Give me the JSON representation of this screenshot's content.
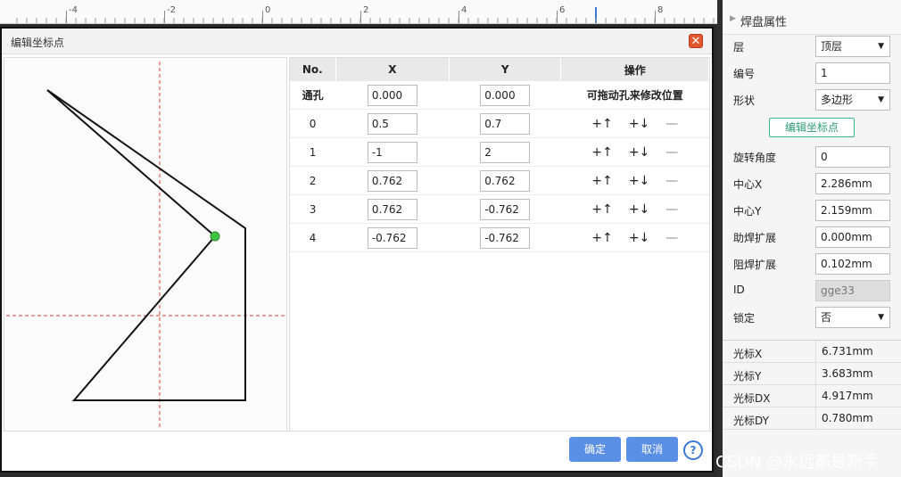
{
  "ruler": {
    "labels": [
      "-4",
      "-2",
      "0",
      "2",
      "4",
      "6",
      "8"
    ]
  },
  "dialog": {
    "title": "编辑坐标点",
    "close_icon": "close-icon",
    "columns": [
      "No.",
      "X",
      "Y",
      "操作"
    ],
    "hole_row": {
      "label": "通孔",
      "x": "0.000",
      "y": "0.000",
      "hint": "可拖动孔来修改位置"
    },
    "rows": [
      {
        "no": "0",
        "x": "0.5",
        "y": "0.7"
      },
      {
        "no": "1",
        "x": "-1",
        "y": "2"
      },
      {
        "no": "2",
        "x": "0.762",
        "y": "0.762"
      },
      {
        "no": "3",
        "x": "0.762",
        "y": "-0.762"
      },
      {
        "no": "4",
        "x": "-0.762",
        "y": "-0.762"
      }
    ],
    "ops": {
      "up": "+↑",
      "down": "+↓",
      "delete": "—"
    },
    "ok_label": "确定",
    "cancel_label": "取消",
    "help_label": "?"
  },
  "panel": {
    "title": "焊盘属性",
    "edit_button": "编辑坐标点",
    "fields": {
      "layer": {
        "label": "层",
        "value": "顶层"
      },
      "number": {
        "label": "编号",
        "value": "1"
      },
      "shape": {
        "label": "形状",
        "value": "多边形"
      },
      "rotation": {
        "label": "旋转角度",
        "value": "0"
      },
      "center_x": {
        "label": "中心X",
        "value": "2.286mm"
      },
      "center_y": {
        "label": "中心Y",
        "value": "2.159mm"
      },
      "paste": {
        "label": "助焊扩展",
        "value": "0.000mm"
      },
      "mask": {
        "label": "阻焊扩展",
        "value": "0.102mm"
      },
      "id": {
        "label": "ID",
        "value": "gge33"
      },
      "lock": {
        "label": "锁定",
        "value": "否"
      }
    },
    "cursor": [
      {
        "label": "光标X",
        "value": "6.731mm"
      },
      {
        "label": "光标Y",
        "value": "3.683mm"
      },
      {
        "label": "光标DX",
        "value": "4.917mm"
      },
      {
        "label": "光标DY",
        "value": "0.780mm"
      }
    ]
  },
  "watermark": "CSDN @永远都是新手",
  "colors": {
    "accent": "#5a8fe6",
    "close": "#e2582e",
    "guide": "#e53935",
    "point": "#3ec43e"
  }
}
